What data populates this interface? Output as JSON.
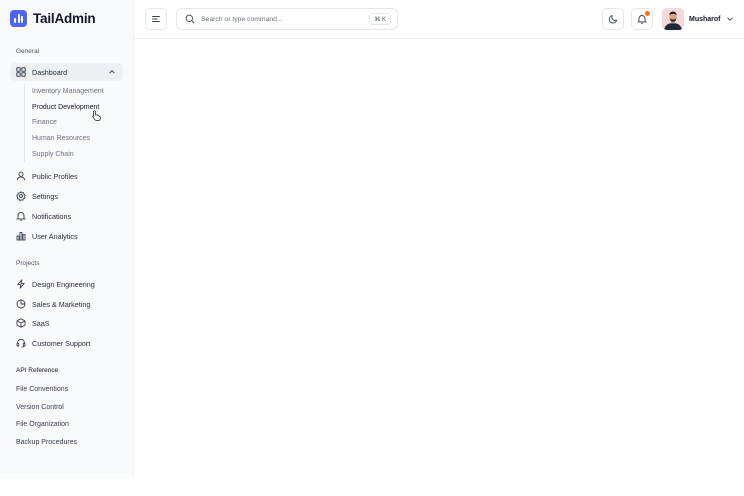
{
  "brand": {
    "name": "TailAdmin",
    "accent": "#4f63f6"
  },
  "sidebar": {
    "general_label": "General",
    "dashboard": {
      "label": "Dashboard",
      "icon": "grid-icon",
      "expanded": true,
      "children": [
        {
          "label": "Inventory Management"
        },
        {
          "label": "Product Development",
          "hovered": true
        },
        {
          "label": "Finance"
        },
        {
          "label": "Human Resources"
        },
        {
          "label": "Supply Chain"
        }
      ]
    },
    "general_items": [
      {
        "label": "Public Profiles",
        "icon": "user-icon"
      },
      {
        "label": "Settings",
        "icon": "gear-icon"
      },
      {
        "label": "Notifications",
        "icon": "bell-icon"
      },
      {
        "label": "User Analytics",
        "icon": "bar-chart-icon"
      }
    ],
    "projects_label": "Projects",
    "project_items": [
      {
        "label": "Design Engineering",
        "icon": "bolt-icon"
      },
      {
        "label": "Sales & Marketing",
        "icon": "pie-chart-icon"
      },
      {
        "label": "SaaS",
        "icon": "cube-icon"
      },
      {
        "label": "Customer Support",
        "icon": "headset-icon"
      }
    ],
    "api_label": "API Reference",
    "api_items": [
      {
        "label": "File Conventions"
      },
      {
        "label": "Version Control"
      },
      {
        "label": "File Organization"
      },
      {
        "label": "Backup Procedures"
      }
    ]
  },
  "topbar": {
    "menu_icon": "menu-icon",
    "search": {
      "placeholder": "Search or type command...",
      "shortcut": "⌘ K",
      "icon": "search-icon"
    },
    "theme_toggle_icon": "moon-icon",
    "notifications_icon": "bell-icon",
    "notification_dot_color": "#f97316",
    "user": {
      "name": "Musharof",
      "icon": "chevron-down-icon"
    }
  }
}
